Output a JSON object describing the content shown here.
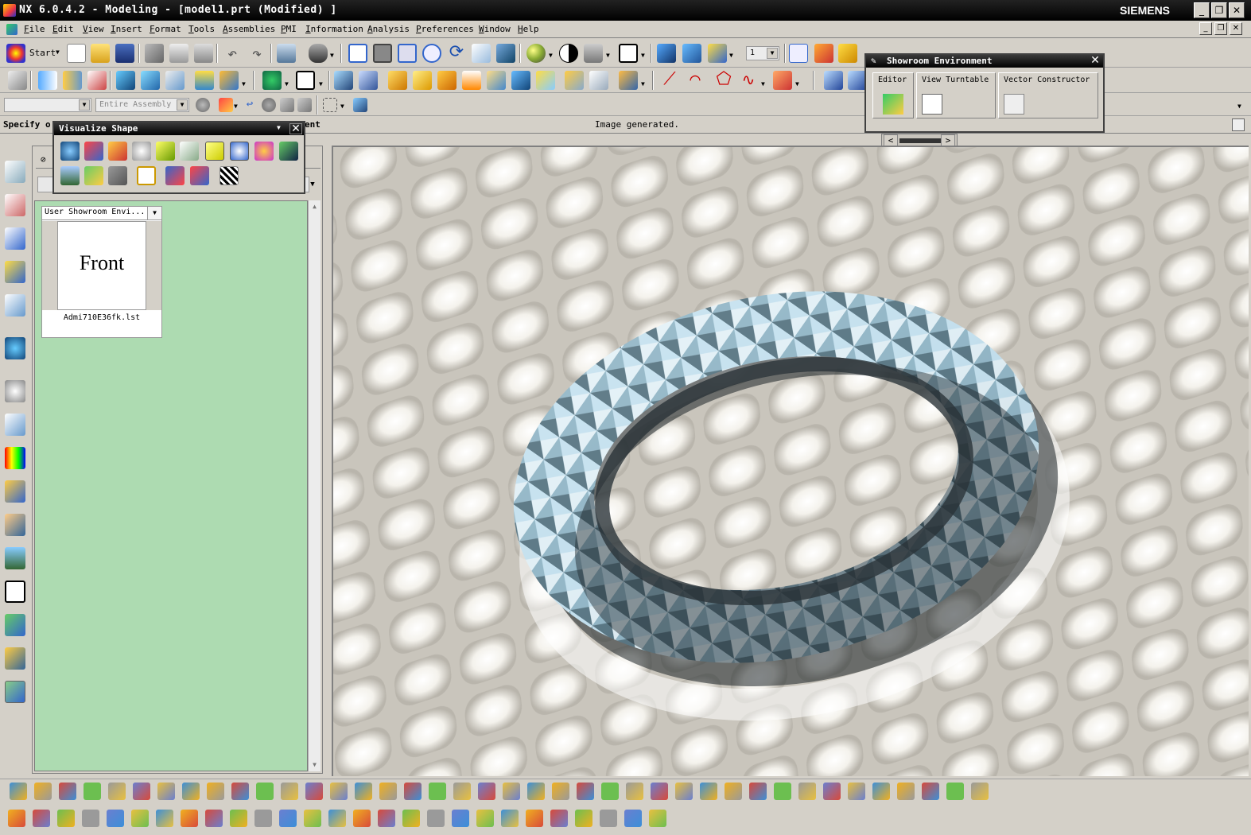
{
  "window": {
    "title": "NX 6.0.4.2 - Modeling - [model1.prt (Modified) ]",
    "brand": "SIEMENS",
    "controls": [
      "_",
      "❐",
      "✕"
    ]
  },
  "menu": [
    "File",
    "Edit",
    "View",
    "Insert",
    "Format",
    "Tools",
    "Assemblies",
    "PMI",
    "Information",
    "Analysis",
    "Preferences",
    "Window",
    "Help"
  ],
  "toolbar": {
    "start_label": "Start",
    "selection_filter": "",
    "scope": "Entire Assembly",
    "layer_value": "1"
  },
  "status": {
    "prompt": "Specify o",
    "prompt_tail": "ent",
    "message": "Image generated."
  },
  "visualize_shape": {
    "title": "Visualize Shape"
  },
  "showroom": {
    "title": "Showroom Environment",
    "items": [
      {
        "label": "Editor",
        "icon": "editor-icon"
      },
      {
        "label": "View Turntable",
        "icon": "turntable-icon"
      },
      {
        "label": "Vector Constructor",
        "icon": "vector-icon"
      }
    ]
  },
  "navigator": {
    "combo_label": "User Showroom Envi...",
    "thumbnail_text": "Front",
    "file_name": "Admi710E36fk.lst"
  },
  "colors": {
    "title_bg": "#000000",
    "chrome": "#d4d0c8",
    "panel_green": "#addbb1",
    "torus_light": "#cfe8f5",
    "torus_dark": "#2c3a42"
  }
}
